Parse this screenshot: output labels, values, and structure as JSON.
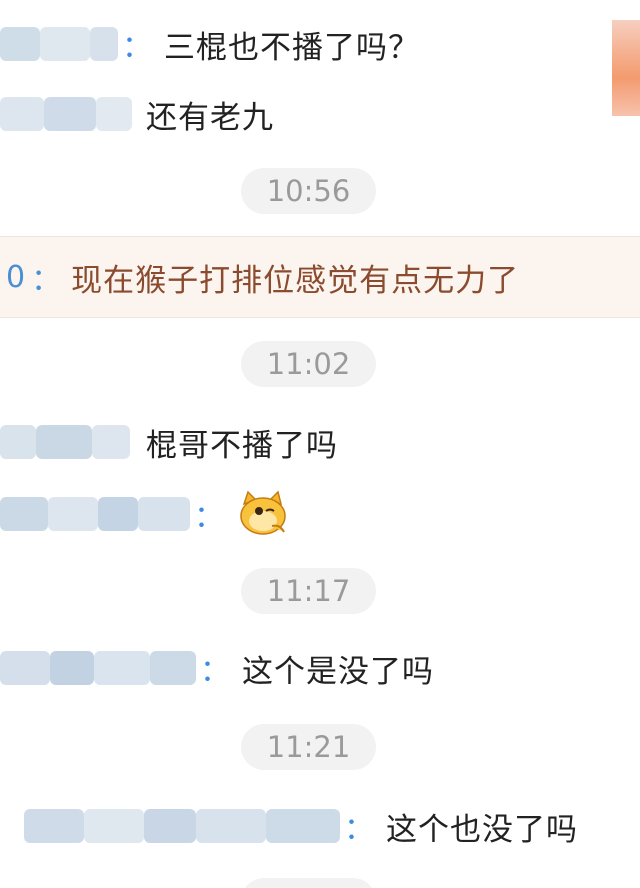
{
  "messages": [
    {
      "text": "三棍也不播了吗？"
    },
    {
      "text": "还有老九"
    },
    {
      "text": "棍哥不播了吗"
    },
    {
      "text": "这个是没了吗"
    },
    {
      "text": "这个也没了吗"
    }
  ],
  "highlight": {
    "number": "0",
    "colon": "：",
    "text": "现在猴子打排位感觉有点无力了"
  },
  "timestamps": [
    "10:56",
    "11:02",
    "11:17",
    "11:21"
  ],
  "colon": "："
}
